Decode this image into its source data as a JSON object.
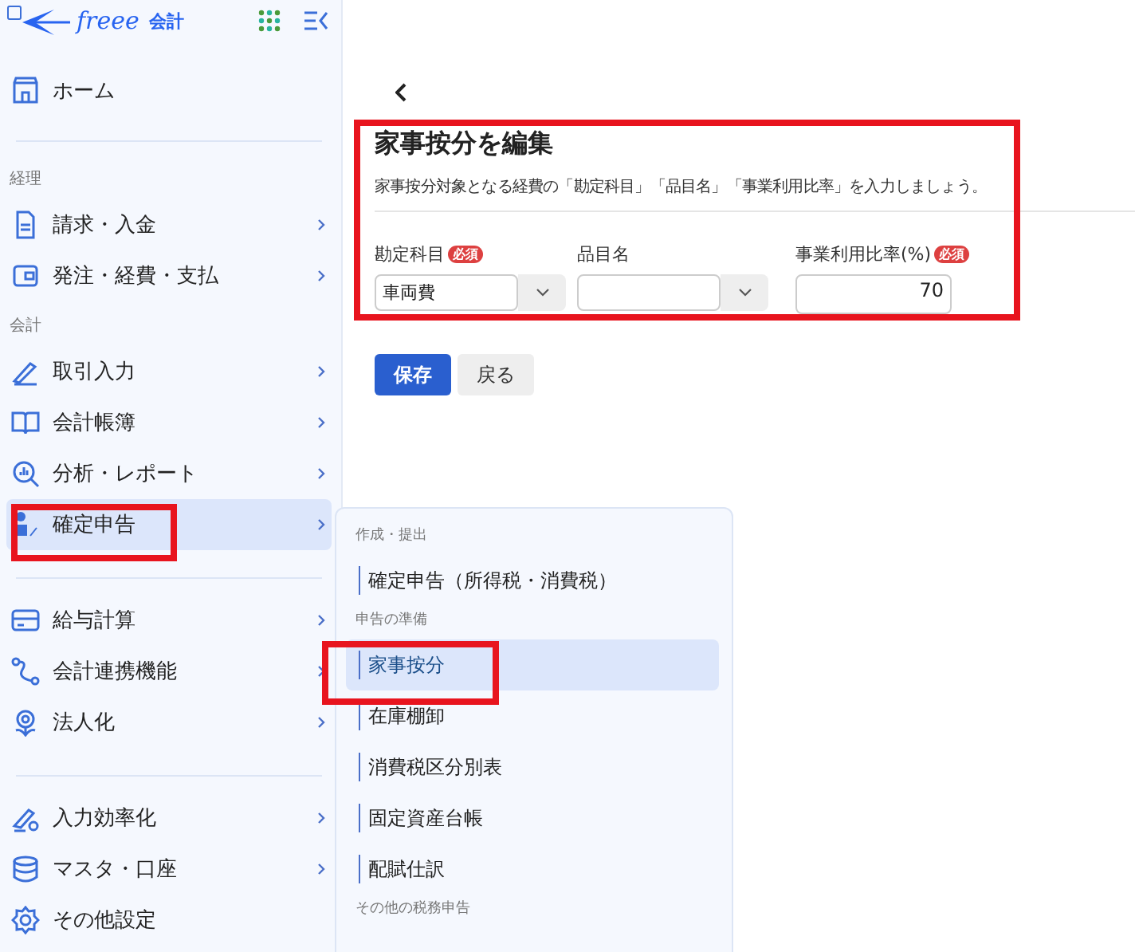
{
  "logo": {
    "brand": "freee",
    "product": "会計"
  },
  "sidebar": {
    "groups": [
      {
        "items": [
          {
            "label": "ホーム",
            "chevron": false,
            "selected": false
          }
        ]
      },
      {
        "heading": "経理",
        "items": [
          {
            "label": "請求・入金",
            "chevron": true,
            "selected": false
          },
          {
            "label": "発注・経費・支払",
            "chevron": true,
            "selected": false
          }
        ]
      },
      {
        "heading": "会計",
        "items": [
          {
            "label": "取引入力",
            "chevron": true,
            "selected": false
          },
          {
            "label": "会計帳簿",
            "chevron": true,
            "selected": false
          },
          {
            "label": "分析・レポート",
            "chevron": true,
            "selected": false
          },
          {
            "label": "確定申告",
            "chevron": true,
            "selected": true
          }
        ]
      },
      {
        "items": [
          {
            "label": "給与計算",
            "chevron": true,
            "selected": false
          },
          {
            "label": "会計連携機能",
            "chevron": true,
            "selected": false
          },
          {
            "label": "法人化",
            "chevron": true,
            "selected": false
          }
        ]
      },
      {
        "items": [
          {
            "label": "入力効率化",
            "chevron": true,
            "selected": false
          },
          {
            "label": "マスタ・口座",
            "chevron": true,
            "selected": false
          },
          {
            "label": "その他設定",
            "chevron": false,
            "selected": false
          }
        ]
      }
    ]
  },
  "submenu": {
    "sections": [
      {
        "heading": "作成・提出",
        "items": [
          {
            "label": "確定申告（所得税・消費税）",
            "selected": false
          }
        ]
      },
      {
        "heading": "申告の準備",
        "items": [
          {
            "label": "家事按分",
            "selected": true
          },
          {
            "label": "在庫棚卸",
            "selected": false
          },
          {
            "label": "消費税区分別表",
            "selected": false
          },
          {
            "label": "固定資産台帳",
            "selected": false
          },
          {
            "label": "配賦仕訳",
            "selected": false
          }
        ]
      },
      {
        "heading": "その他の税務申告"
      }
    ]
  },
  "page": {
    "title": "家事按分を編集",
    "description": "家事按分対象となる経費の「勘定科目」「品目名」「事業利用比率」を入力しましょう。",
    "fields": [
      {
        "label": "勘定科目",
        "badge": "必須",
        "kind": "select",
        "value": "車両費"
      },
      {
        "label": "品目名",
        "kind": "select"
      },
      {
        "label": "事業利用比率(%)",
        "badge": "必須",
        "kind": "number",
        "value": "70"
      }
    ],
    "buttons": [
      {
        "label": "保存",
        "kind": "primary"
      },
      {
        "label": "戻る",
        "kind": "secondary"
      }
    ]
  }
}
